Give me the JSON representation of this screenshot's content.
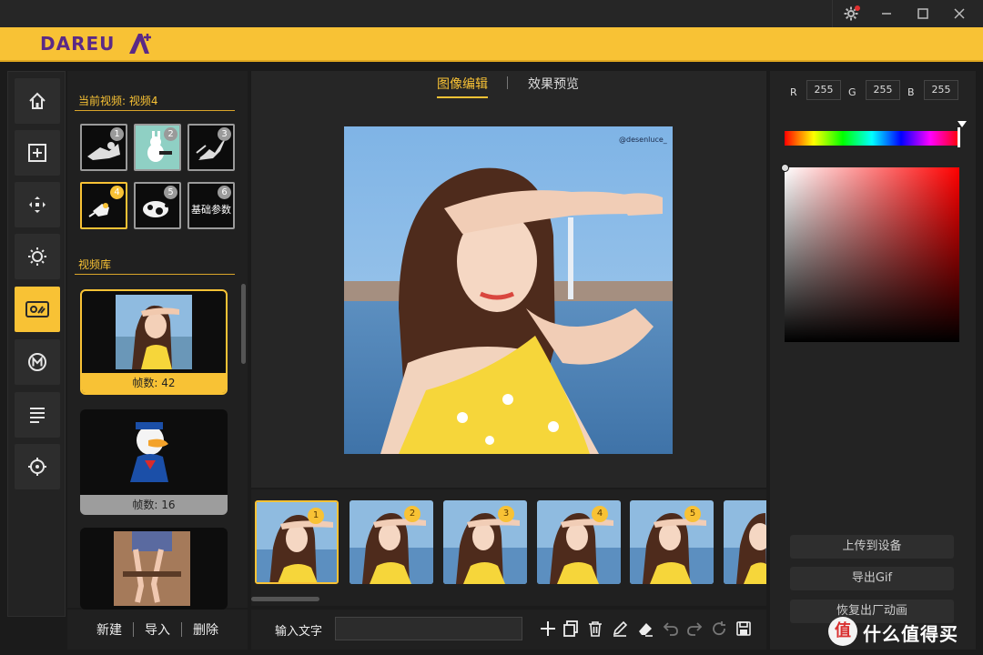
{
  "window": {
    "settings_icon": "gear-icon",
    "minimize_icon": "minimize-icon",
    "maximize_icon": "maximize-icon",
    "close_icon": "close-icon"
  },
  "brand": {
    "logo_text": "DAREU",
    "accent_color": "#f8c235",
    "logo_color": "#5b2a86"
  },
  "left_nav": [
    {
      "icon": "home-icon",
      "active": false
    },
    {
      "icon": "add-icon",
      "active": false
    },
    {
      "icon": "move-icon",
      "active": false
    },
    {
      "icon": "sun-icon",
      "active": false
    },
    {
      "icon": "video-card-icon",
      "active": true
    },
    {
      "icon": "macro-m-icon",
      "active": false
    },
    {
      "icon": "list-icon",
      "active": false
    },
    {
      "icon": "crosshair-icon",
      "active": false
    }
  ],
  "current_video": {
    "title": "当前视频: 视频4",
    "slots": [
      {
        "num": "1",
        "selected": false
      },
      {
        "num": "2",
        "selected": false
      },
      {
        "num": "3",
        "selected": false
      },
      {
        "num": "4",
        "selected": true
      },
      {
        "num": "5",
        "selected": false
      },
      {
        "num": "6",
        "selected": false,
        "label": "基础参数"
      }
    ]
  },
  "library": {
    "title": "视频库",
    "items": [
      {
        "frames_label": "帧数: 42",
        "selected": true
      },
      {
        "frames_label": "帧数: 16",
        "selected": false
      },
      {
        "frames_label": "",
        "selected": false
      }
    ]
  },
  "left_actions": {
    "new": "新建",
    "import": "导入",
    "delete": "删除"
  },
  "tabs": {
    "edit": "图像编辑",
    "preview": "效果预览"
  },
  "main_image": {
    "watermark_text": "@desenluce_"
  },
  "timeline": {
    "frames": [
      "1",
      "2",
      "3",
      "4",
      "5"
    ]
  },
  "text_tool": {
    "label": "输入文字",
    "input_value": ""
  },
  "toolbar_icons": [
    "add-icon",
    "copy-icon",
    "trash-icon",
    "pen-icon",
    "eraser-icon",
    "undo-icon",
    "redo-icon",
    "refresh-icon",
    "save-icon"
  ],
  "color": {
    "r_label": "R",
    "g_label": "G",
    "b_label": "B",
    "r": "255",
    "g": "255",
    "b": "255"
  },
  "right_actions": {
    "upload": "上传到设备",
    "export": "导出Gif",
    "restore": "恢复出厂动画"
  },
  "watermark": {
    "badge": "值",
    "text": "什么值得买"
  }
}
